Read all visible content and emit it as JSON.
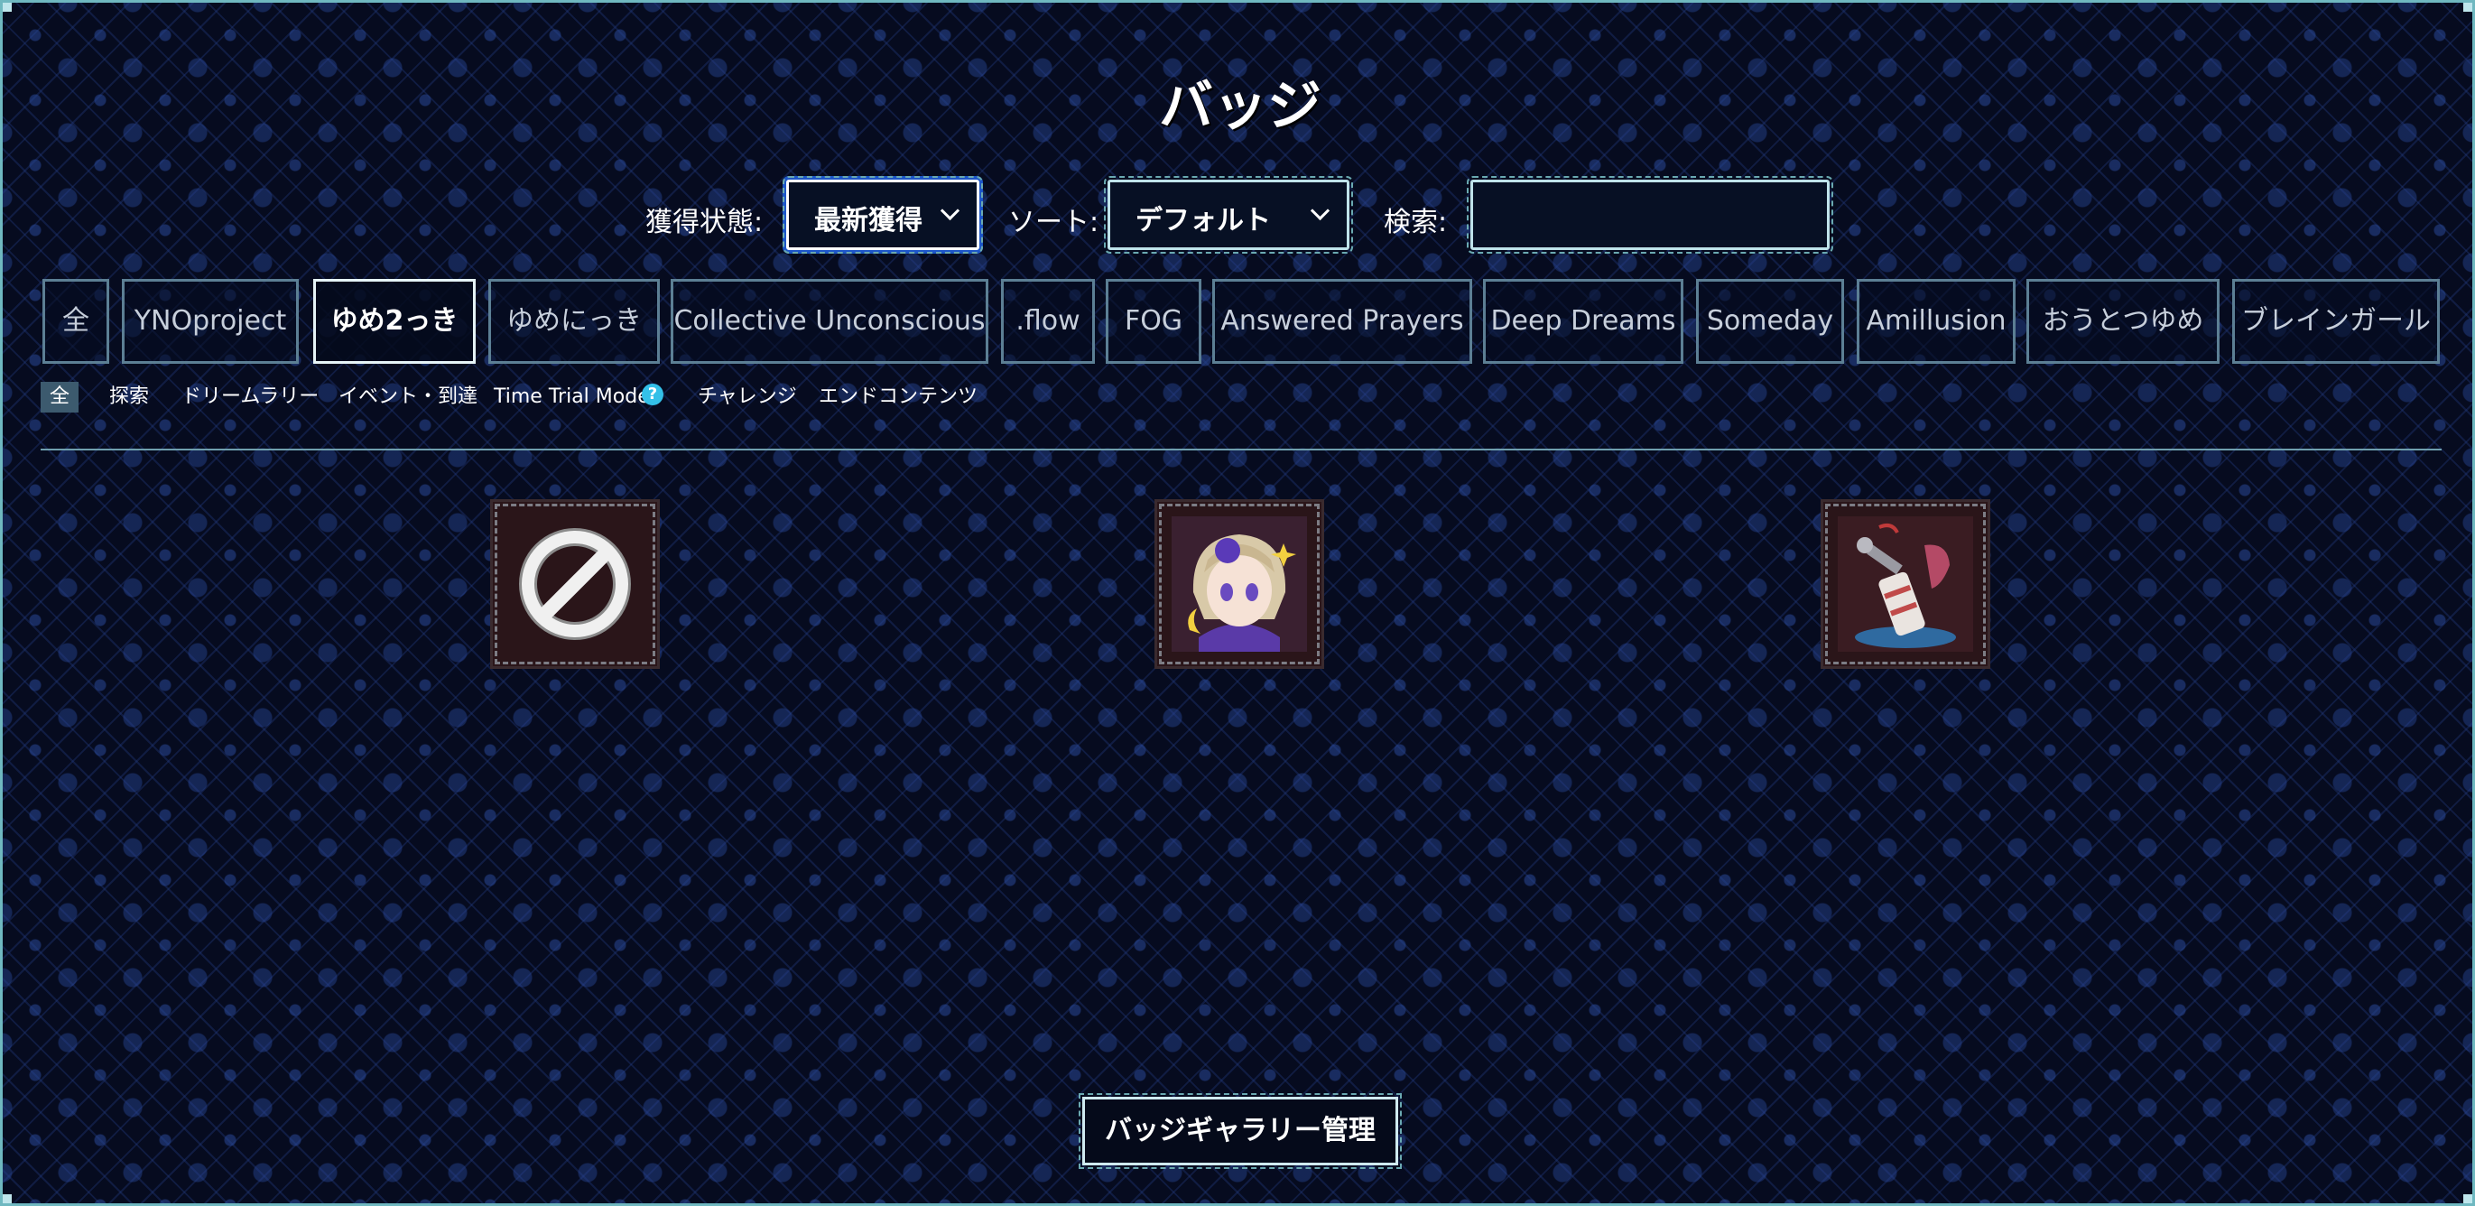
{
  "page": {
    "title": "バッジ"
  },
  "filters": {
    "status_label": "獲得状態:",
    "status_value": "最新獲得",
    "sort_label": "ソート:",
    "sort_value": "デフォルト",
    "search_label": "検索:",
    "search_value": ""
  },
  "game_tabs": [
    {
      "label": "全",
      "active": false
    },
    {
      "label": "YNOproject",
      "active": false
    },
    {
      "label": "ゆめ2っき",
      "active": true
    },
    {
      "label": "ゆめにっき",
      "active": false
    },
    {
      "label": "Collective Unconscious",
      "active": false
    },
    {
      "label": ".flow",
      "active": false
    },
    {
      "label": "FOG",
      "active": false
    },
    {
      "label": "Answered Prayers",
      "active": false
    },
    {
      "label": "Deep Dreams",
      "active": false
    },
    {
      "label": "Someday",
      "active": false
    },
    {
      "label": "Amillusion",
      "active": false
    },
    {
      "label": "おうとつゆめ",
      "active": false
    },
    {
      "label": "ブレインガール",
      "active": false
    }
  ],
  "category_tabs": [
    {
      "label": "全",
      "active": true
    },
    {
      "label": "探索",
      "active": false
    },
    {
      "label": "ドリームラリー",
      "active": false
    },
    {
      "label": "イベント・到達",
      "active": false
    },
    {
      "label": "Time Trial Mode",
      "active": false,
      "help_icon": "?"
    },
    {
      "label": "チャレンジ",
      "active": false
    },
    {
      "label": "エンドコンテンツ",
      "active": false
    }
  ],
  "badges": [
    {
      "icon": "no-badge-icon"
    },
    {
      "icon": "character-portrait-icon"
    },
    {
      "icon": "sword-bundle-icon"
    }
  ],
  "footer": {
    "gallery_button": "バッジギャラリー管理"
  }
}
